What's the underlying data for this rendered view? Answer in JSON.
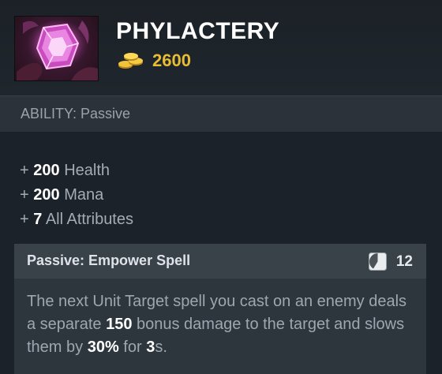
{
  "item": {
    "name": "PHYLACTERY",
    "cost": "2600",
    "icon": "phylactery-item-icon",
    "gold_icon": "gold-coins-icon"
  },
  "ability": {
    "label": "ABILITY: Passive"
  },
  "stats": [
    {
      "prefix": "+",
      "value": "200",
      "name": "Health"
    },
    {
      "prefix": "+",
      "value": "200",
      "name": "Mana"
    },
    {
      "prefix": "+",
      "value": "7",
      "name": "All Attributes"
    }
  ],
  "passive": {
    "title": "Passive: Empower Spell",
    "cooldown": "12",
    "cooldown_icon": "cooldown-icon",
    "desc": {
      "t1": "The next Unit Target spell you cast on an enemy deals a separate ",
      "v1": "150",
      "t2": " bonus damage to the target and slows them by ",
      "v2": "30%",
      "t3": " for ",
      "v3": "3",
      "t4": "s."
    }
  },
  "colors": {
    "gold": "#e8bd33",
    "title": "#ffffff",
    "text": "#a3acb4",
    "panel": "#2d353d"
  }
}
